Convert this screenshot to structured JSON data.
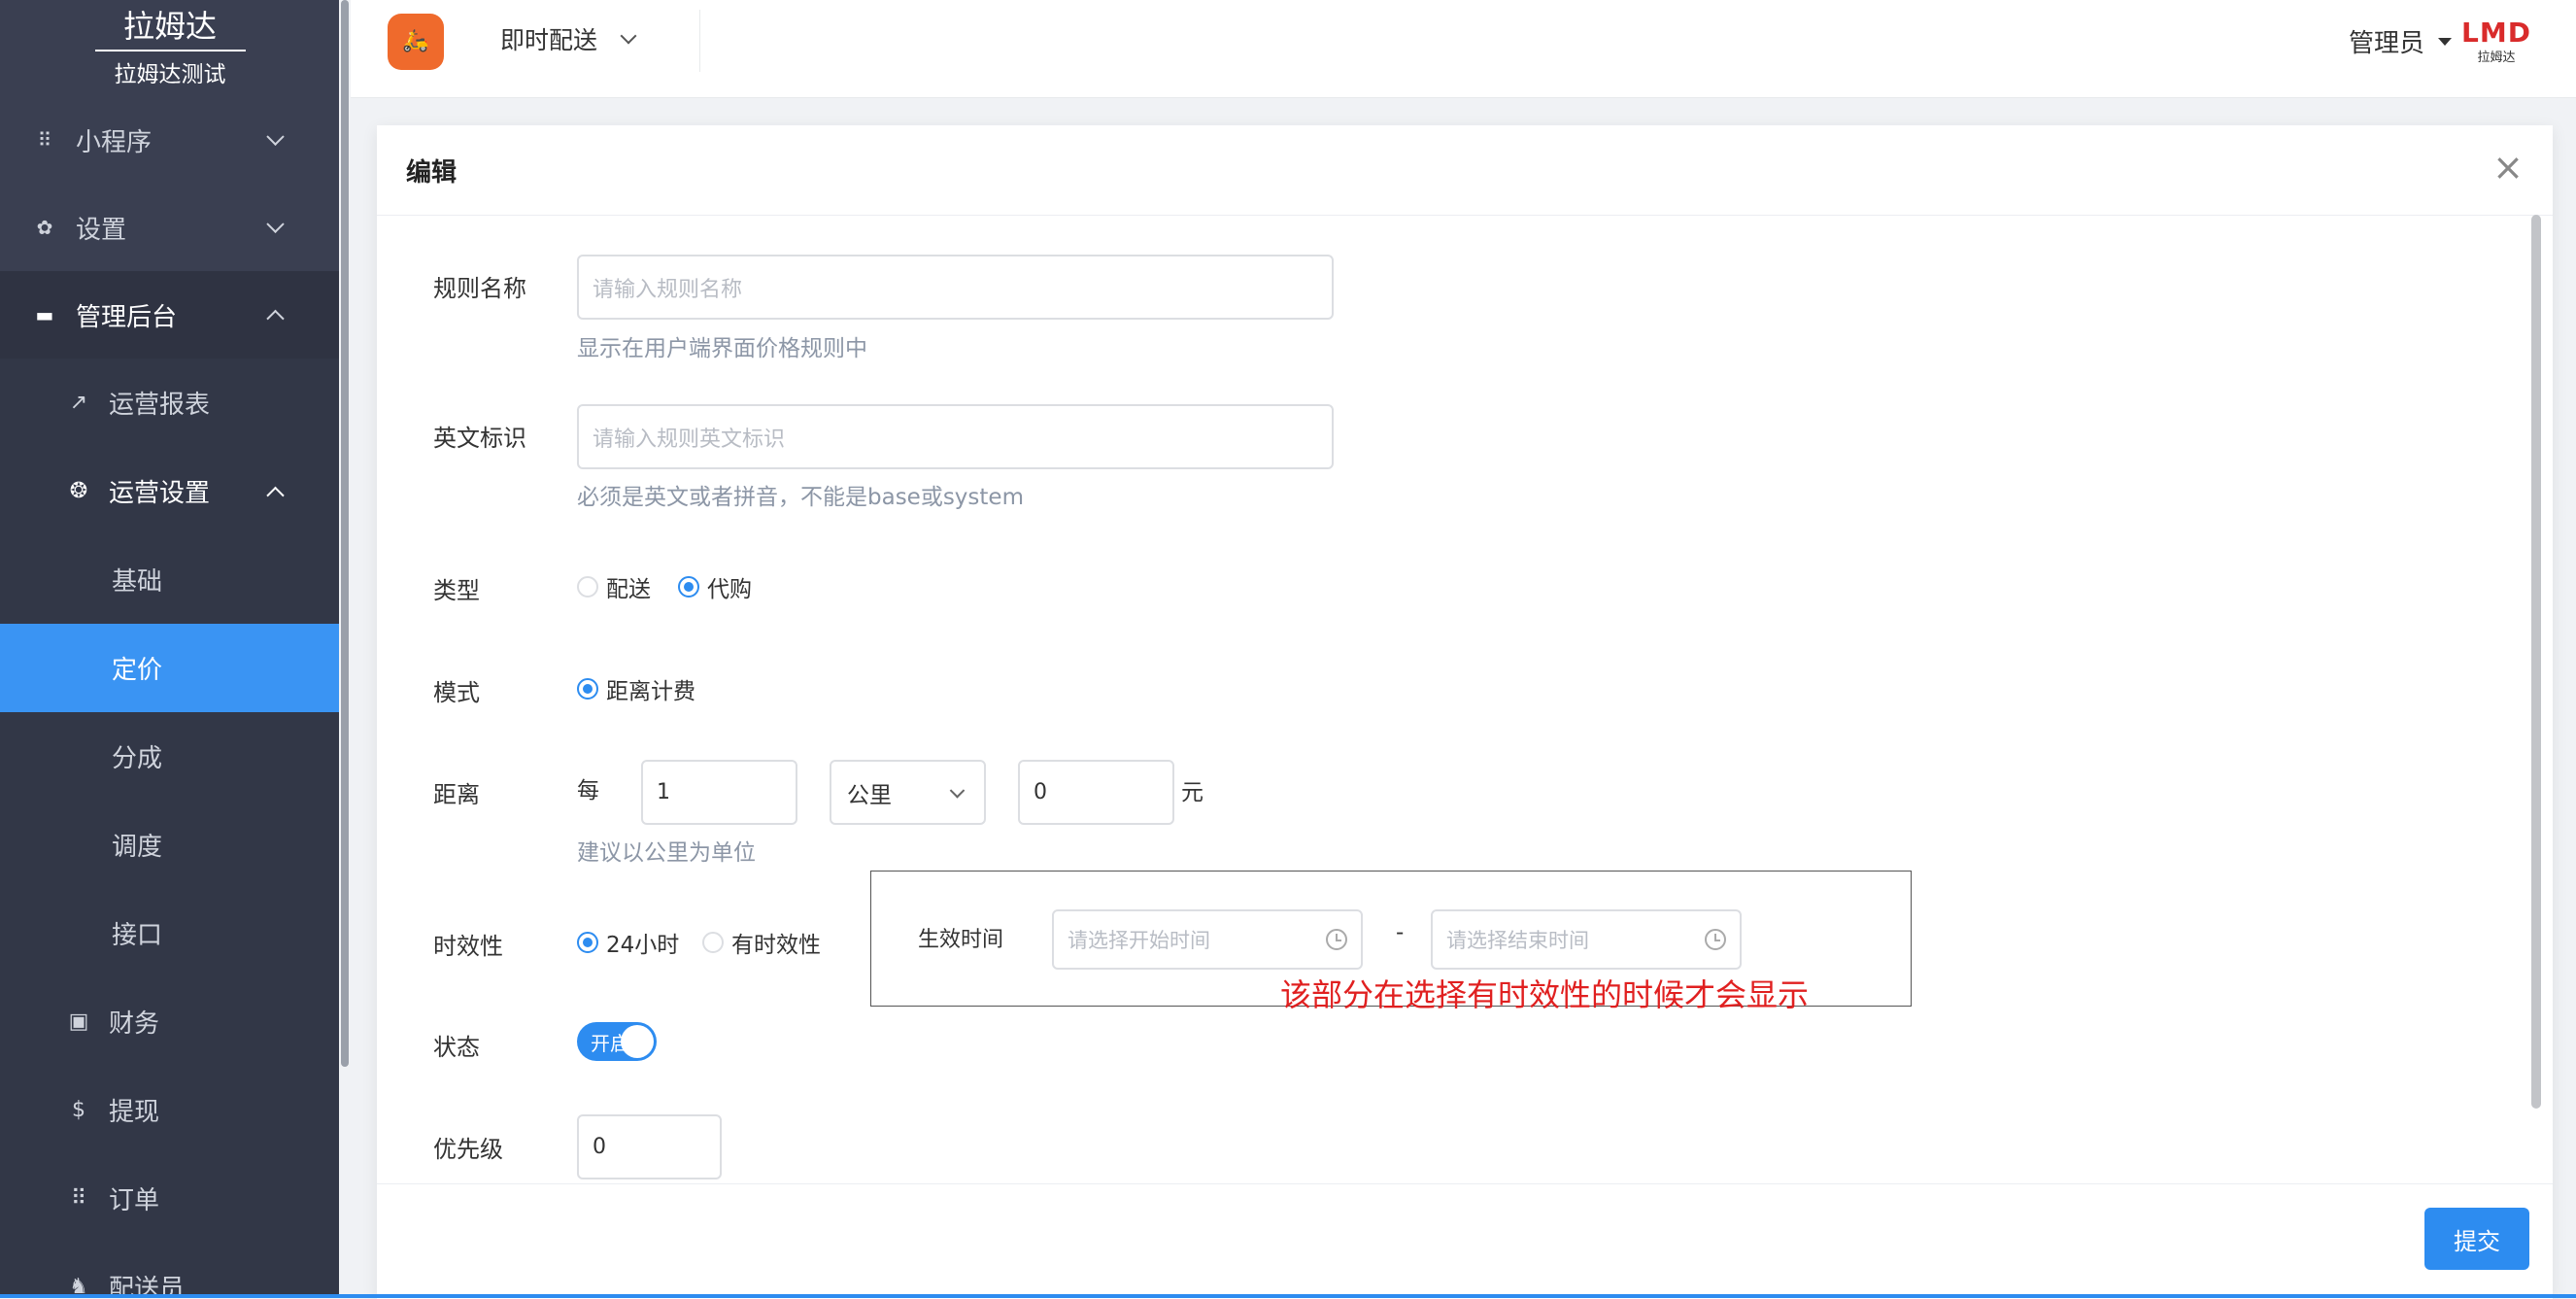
{
  "sidebar": {
    "title": "拉姆达",
    "subtitle": "拉姆达测试",
    "menus": [
      {
        "label": "小程序",
        "icon": "grid-icon",
        "expanded": false
      },
      {
        "label": "设置",
        "icon": "gear-icon",
        "expanded": false
      },
      {
        "label": "管理后台",
        "icon": "monitor-icon",
        "expanded": true
      }
    ],
    "sub_items": [
      {
        "label": "运营报表",
        "icon": "trend-icon"
      },
      {
        "label": "运营设置",
        "icon": "aperture-icon",
        "expanded": true
      },
      {
        "label": "基础"
      },
      {
        "label": "定价",
        "selected": true
      },
      {
        "label": "分成"
      },
      {
        "label": "调度"
      },
      {
        "label": "接口"
      },
      {
        "label": "财务",
        "icon": "money-icon"
      },
      {
        "label": "提现",
        "icon": "dollar-icon"
      },
      {
        "label": "订单",
        "icon": "grid-icon"
      },
      {
        "label": "配送员",
        "icon": "rider-icon"
      }
    ]
  },
  "header": {
    "app_name": "即时配送",
    "user": "管理员",
    "brand_mark": "LMD",
    "brand_sub": "拉姆达"
  },
  "modal": {
    "title": "编辑",
    "close_symbol": "×",
    "rule_name": {
      "label": "规则名称",
      "placeholder": "请输入规则名称",
      "hint": "显示在用户端界面价格规则中"
    },
    "en_id": {
      "label": "英文标识",
      "placeholder": "请输入规则英文标识",
      "hint": "必须是英文或者拼音，不能是base或system"
    },
    "type": {
      "label": "类型",
      "options": [
        "配送",
        "代购"
      ],
      "selected": "代购"
    },
    "mode": {
      "label": "模式",
      "option": "距离计费"
    },
    "distance": {
      "label": "距离",
      "per": "每",
      "value": "1",
      "unit": "公里",
      "price": "0",
      "currency": "元",
      "hint": "建议以公里为单位"
    },
    "validity": {
      "label": "时效性",
      "options": [
        "24小时",
        "有时效性"
      ],
      "selected": "24小时"
    },
    "effective": {
      "label": "生效时间",
      "start_placeholder": "请选择开始时间",
      "separator": "-",
      "end_placeholder": "请选择结束时间",
      "note": "该部分在选择有时效性的时候才会显示"
    },
    "status": {
      "label": "状态",
      "switch_text": "开启",
      "on": true
    },
    "priority": {
      "label": "优先级",
      "value": "0"
    },
    "submit": "提交"
  },
  "colors": {
    "accent": "#2d8cf0",
    "sidebar_bg": "#3a3f51",
    "selected_bg": "#3a94f3",
    "note_red": "#e02020"
  }
}
